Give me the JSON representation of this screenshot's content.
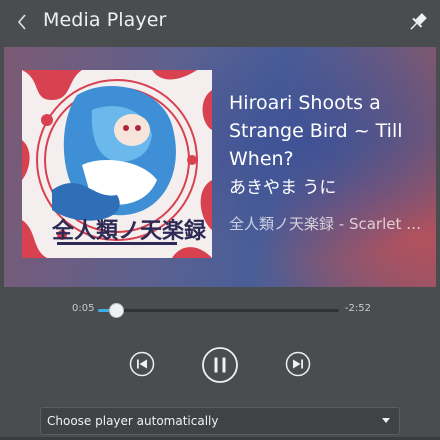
{
  "header": {
    "title": "Media Player",
    "back_icon": "chevron-left-icon",
    "pin_icon": "pin-icon"
  },
  "track": {
    "title": "Hiroari Shoots a Strange Bird ~ Till When?",
    "artist": "あきやま うに",
    "album": "全人類ノ天楽録 - Scarlet Devil Land"
  },
  "playback": {
    "elapsed": "0:05",
    "remaining": "-2:52",
    "progress_fraction": 0.073,
    "state": "playing"
  },
  "controls": {
    "previous_icon": "skip-previous-icon",
    "pause_icon": "pause-icon",
    "next_icon": "skip-next-icon"
  },
  "player_select": {
    "value": "Choose player automatically"
  },
  "colors": {
    "accent": "#3daee9",
    "background": "#4a4d50"
  }
}
